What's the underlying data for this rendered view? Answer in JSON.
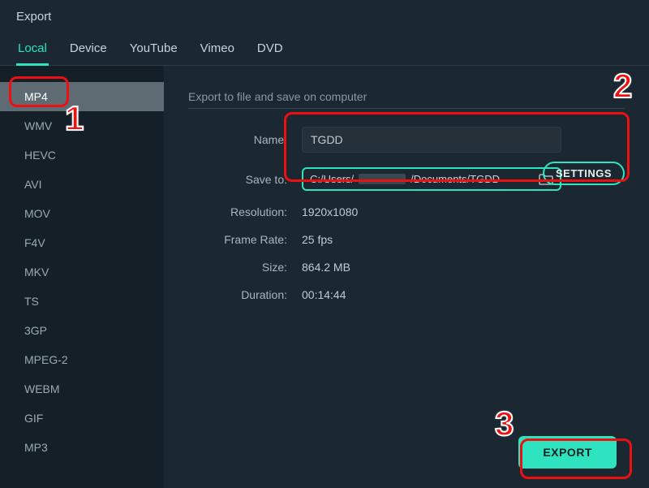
{
  "window": {
    "title": "Export"
  },
  "tabs": {
    "local": "Local",
    "device": "Device",
    "youtube": "YouTube",
    "vimeo": "Vimeo",
    "dvd": "DVD"
  },
  "formats": {
    "mp4": "MP4",
    "wmv": "WMV",
    "hevc": "HEVC",
    "avi": "AVI",
    "mov": "MOV",
    "f4v": "F4V",
    "mkv": "MKV",
    "ts": "TS",
    "3gp": "3GP",
    "mpeg2": "MPEG-2",
    "webm": "WEBM",
    "gif": "GIF",
    "mp3": "MP3"
  },
  "section": {
    "heading": "Export to file and save on computer"
  },
  "labels": {
    "name": "Name:",
    "saveto": "Save to:",
    "resolution": "Resolution:",
    "framerate": "Frame Rate:",
    "size": "Size:",
    "duration": "Duration:"
  },
  "fields": {
    "name_value": "TGDD",
    "path_prefix": "C:/Users/",
    "path_suffix": "/Documents/TGDD",
    "resolution": "1920x1080",
    "framerate": "25 fps",
    "size": "864.2 MB",
    "duration": "00:14:44"
  },
  "buttons": {
    "settings": "SETTINGS",
    "export": "EXPORT"
  },
  "annotations": {
    "n1": "1",
    "n2": "2",
    "n3": "3"
  }
}
